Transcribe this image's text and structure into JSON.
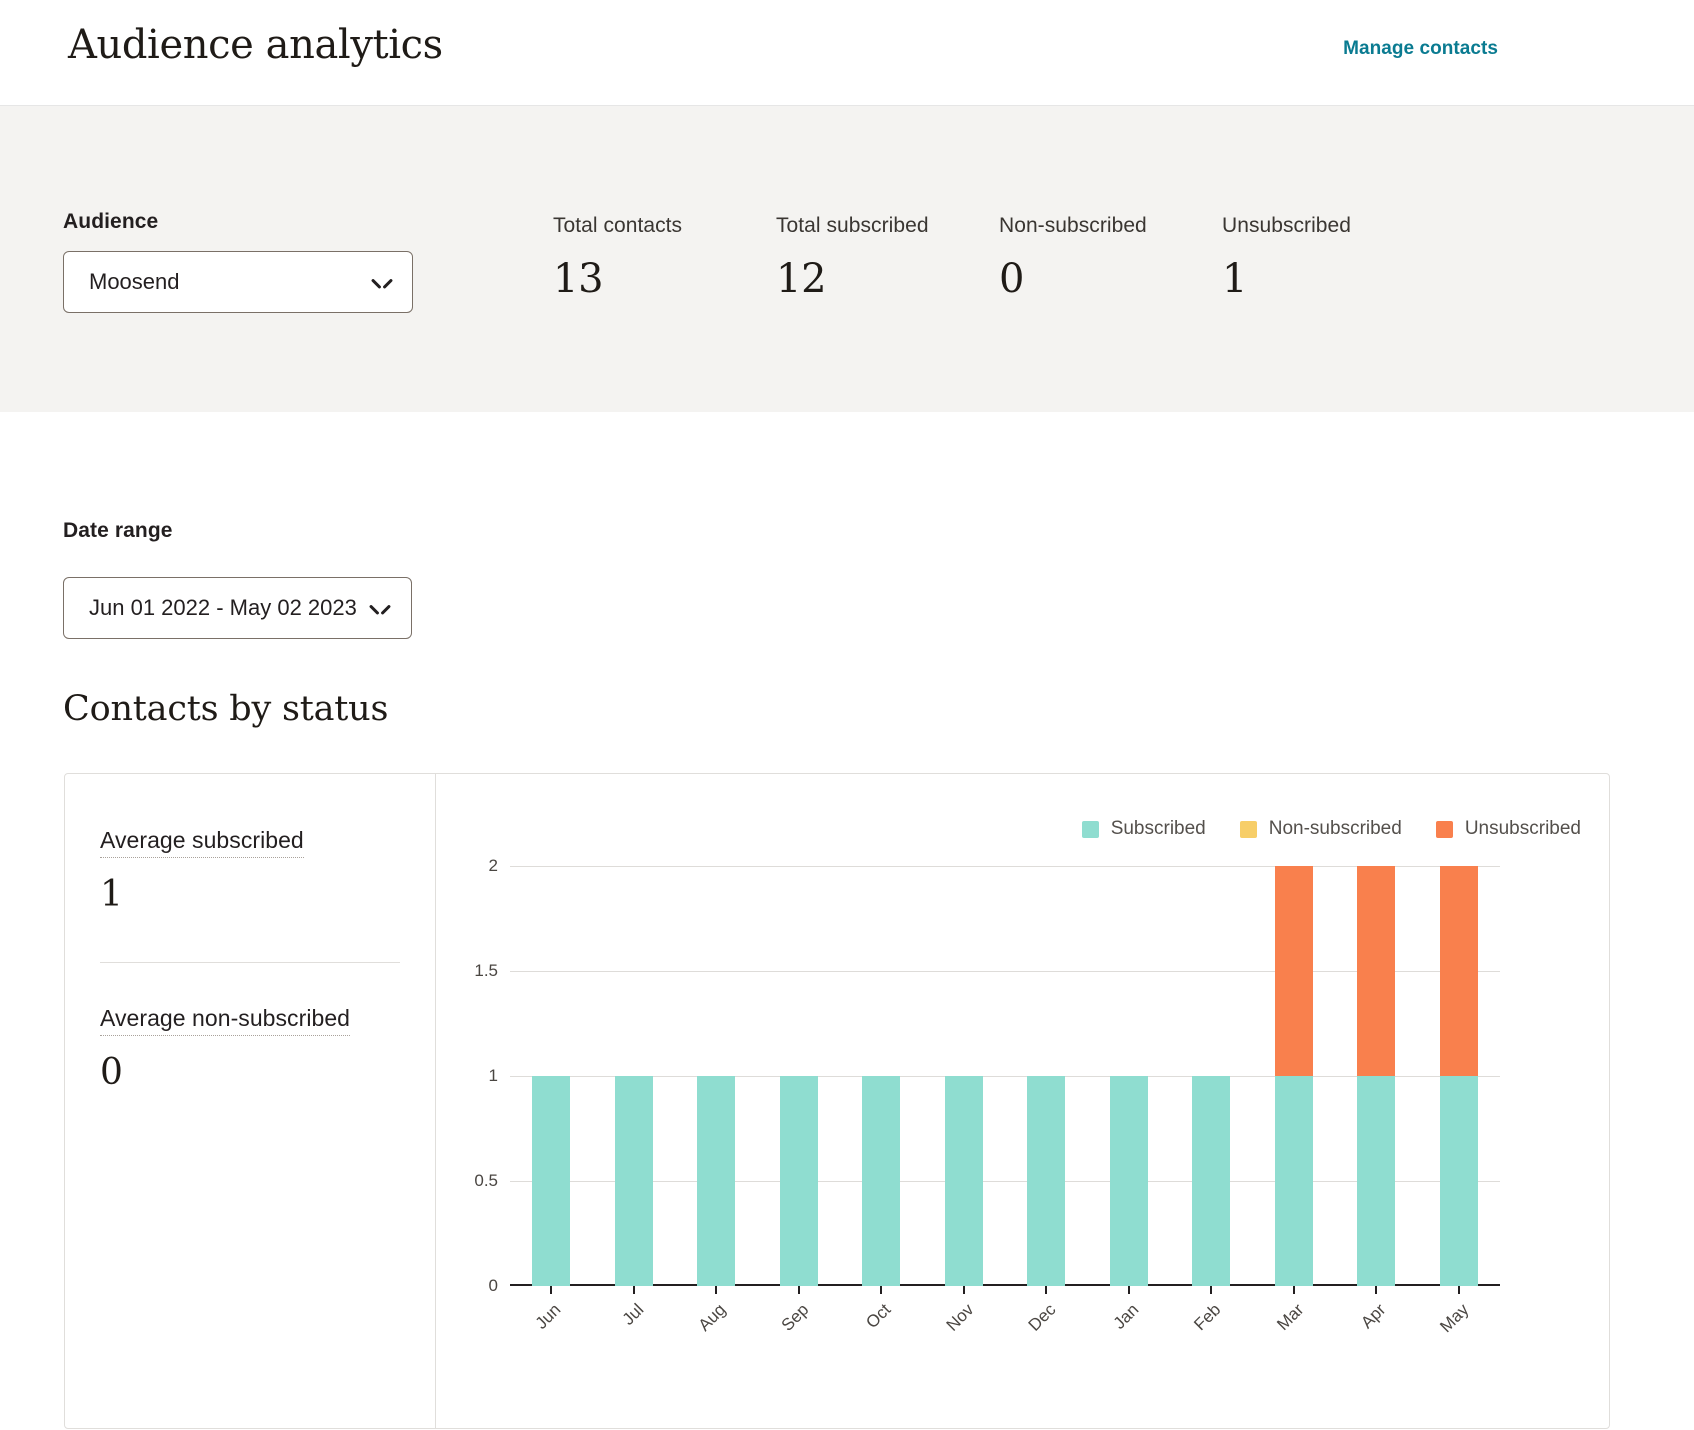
{
  "header": {
    "title": "Audience analytics",
    "manage_link": "Manage contacts",
    "link_color": "#0a7b91"
  },
  "summary": {
    "audience_label": "Audience",
    "audience_value": "Moosend",
    "stats": [
      {
        "label": "Total contacts",
        "value": "13"
      },
      {
        "label": "Total subscribed",
        "value": "12"
      },
      {
        "label": "Non-subscribed",
        "value": "0"
      },
      {
        "label": "Unsubscribed",
        "value": "1"
      }
    ]
  },
  "date_range": {
    "label": "Date range",
    "value": "Jun 01 2022 - May 02 2023"
  },
  "section": {
    "title": "Contacts by status"
  },
  "metrics": [
    {
      "label": "Average subscribed",
      "value": "1"
    },
    {
      "label": "Average non-subscribed",
      "value": "0"
    }
  ],
  "chart_data": {
    "type": "bar",
    "stacked": true,
    "title": "Contacts by status",
    "xlabel": "",
    "ylabel": "",
    "ylim": [
      0,
      2
    ],
    "yticks": [
      "0",
      "0.5",
      "1",
      "1.5",
      "2"
    ],
    "ytick_values": [
      0,
      0.5,
      1,
      1.5,
      2
    ],
    "grid": true,
    "legend_position": "top-right",
    "categories": [
      "Jun",
      "Jul",
      "Aug",
      "Sep",
      "Oct",
      "Nov",
      "Dec",
      "Jan",
      "Feb",
      "Mar",
      "Apr",
      "May"
    ],
    "series": [
      {
        "name": "Subscribed",
        "color": "#8FDDD0",
        "values": [
          1,
          1,
          1,
          1,
          1,
          1,
          1,
          1,
          1,
          1,
          1,
          1
        ]
      },
      {
        "name": "Non-subscribed",
        "color": "#F7CE68",
        "values": [
          0,
          0,
          0,
          0,
          0,
          0,
          0,
          0,
          0,
          0,
          0,
          0
        ]
      },
      {
        "name": "Unsubscribed",
        "color": "#F9804D",
        "values": [
          0,
          0,
          0,
          0,
          0,
          0,
          0,
          0,
          0,
          1,
          1,
          1
        ]
      }
    ]
  }
}
